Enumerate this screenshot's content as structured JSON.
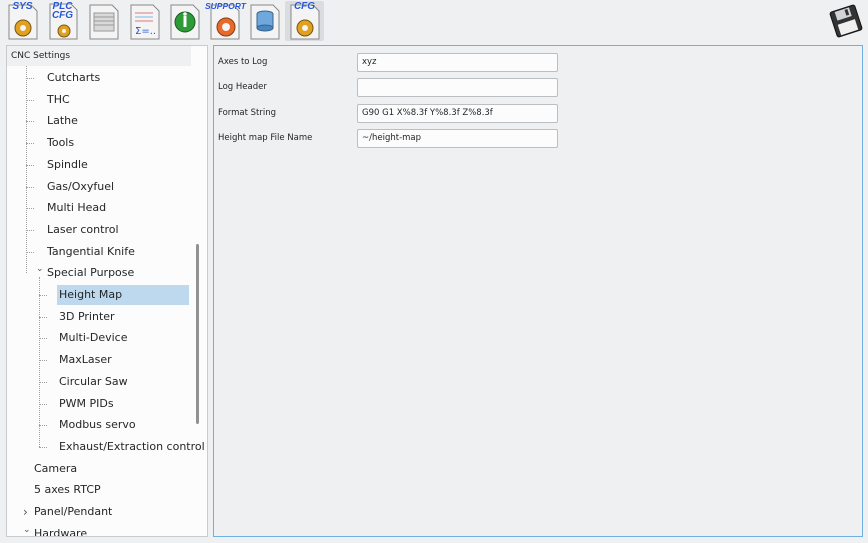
{
  "toolbar": {
    "buttons": [
      {
        "id": "sys",
        "label": "SYS"
      },
      {
        "id": "plc",
        "label": "PLC\nCFG"
      },
      {
        "id": "report",
        "label": ""
      },
      {
        "id": "formula",
        "label": ""
      },
      {
        "id": "info",
        "label": ""
      },
      {
        "id": "support",
        "label": "SUPPORT"
      },
      {
        "id": "database",
        "label": ""
      },
      {
        "id": "cfg",
        "label": "CFG"
      }
    ]
  },
  "sidebar": {
    "header": "CNC Settings",
    "items": [
      {
        "label": "Cutcharts",
        "level": 1
      },
      {
        "label": "THC",
        "level": 1
      },
      {
        "label": "Lathe",
        "level": 1
      },
      {
        "label": "Tools",
        "level": 1
      },
      {
        "label": "Spindle",
        "level": 1
      },
      {
        "label": "Gas/Oxyfuel",
        "level": 1
      },
      {
        "label": "Multi Head",
        "level": 1
      },
      {
        "label": "Laser control",
        "level": 1
      },
      {
        "label": "Tangential Knife",
        "level": 1
      },
      {
        "label": "Special Purpose",
        "level": 1,
        "expanded": true
      },
      {
        "label": "Height Map",
        "level": 2,
        "selected": true
      },
      {
        "label": "3D Printer",
        "level": 2
      },
      {
        "label": "Multi-Device",
        "level": 2
      },
      {
        "label": "MaxLaser",
        "level": 2
      },
      {
        "label": "Circular Saw",
        "level": 2
      },
      {
        "label": "PWM PIDs",
        "level": 2
      },
      {
        "label": "Modbus servo",
        "level": 2
      },
      {
        "label": "Exhaust/Extraction control",
        "level": 2
      },
      {
        "label": "Camera",
        "level": 0
      },
      {
        "label": "5 axes RTCP",
        "level": 0
      },
      {
        "label": "Panel/Pendant",
        "level": 0,
        "collapsed": true
      },
      {
        "label": "Hardware",
        "level": 0,
        "expanded": true
      }
    ]
  },
  "form": {
    "fields": [
      {
        "label": "Axes to Log",
        "value": "xyz"
      },
      {
        "label": "Log Header",
        "value": ""
      },
      {
        "label": "Format String",
        "value": "G90 G1 X%8.3f Y%8.3f Z%8.3f"
      },
      {
        "label": "Height map File Name",
        "value": "~/height-map"
      }
    ]
  },
  "colors": {
    "accent": "#3daee9",
    "selection": "#bed8ee",
    "window": "#eff0f1"
  }
}
